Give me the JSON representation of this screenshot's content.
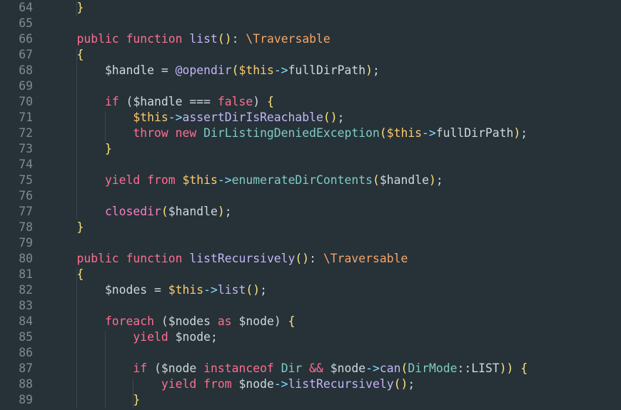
{
  "editor": {
    "first_line": 64,
    "lines": [
      {
        "n": "64",
        "tokens": [
          {
            "t": "    }",
            "c": "brace"
          }
        ]
      },
      {
        "n": "65",
        "tokens": []
      },
      {
        "n": "66",
        "tokens": [
          {
            "t": "    public",
            "c": "keyword"
          },
          {
            "t": " ",
            "c": "default"
          },
          {
            "t": "function",
            "c": "keyword"
          },
          {
            "t": " ",
            "c": "default"
          },
          {
            "t": "list",
            "c": "method"
          },
          {
            "t": "()",
            "c": "paren"
          },
          {
            "t": ": ",
            "c": "default"
          },
          {
            "t": "\\Traversable",
            "c": "type"
          }
        ]
      },
      {
        "n": "67",
        "tokens": [
          {
            "t": "    {",
            "c": "brace"
          }
        ]
      },
      {
        "n": "68",
        "tokens": [
          {
            "t": "        $handle",
            "c": "default"
          },
          {
            "t": " = ",
            "c": "default"
          },
          {
            "t": "@opendir",
            "c": "method"
          },
          {
            "t": "(",
            "c": "paren"
          },
          {
            "t": "$this",
            "c": "variable"
          },
          {
            "t": "->",
            "c": "punct"
          },
          {
            "t": "fullDirPath",
            "c": "default"
          },
          {
            "t": ")",
            "c": "paren"
          },
          {
            "t": ";",
            "c": "default"
          }
        ]
      },
      {
        "n": "69",
        "tokens": []
      },
      {
        "n": "70",
        "tokens": [
          {
            "t": "        if",
            "c": "keyword"
          },
          {
            "t": " (",
            "c": "default"
          },
          {
            "t": "$handle",
            "c": "default"
          },
          {
            "t": " === ",
            "c": "default"
          },
          {
            "t": "false",
            "c": "keyword"
          },
          {
            "t": ") ",
            "c": "default"
          },
          {
            "t": "{",
            "c": "brace"
          }
        ]
      },
      {
        "n": "71",
        "tokens": [
          {
            "t": "            $this",
            "c": "variable"
          },
          {
            "t": "->",
            "c": "punct"
          },
          {
            "t": "assertDirIsReachable",
            "c": "method"
          },
          {
            "t": "()",
            "c": "paren"
          },
          {
            "t": ";",
            "c": "default"
          }
        ]
      },
      {
        "n": "72",
        "tokens": [
          {
            "t": "            throw",
            "c": "keyword"
          },
          {
            "t": " ",
            "c": "default"
          },
          {
            "t": "new",
            "c": "keyword"
          },
          {
            "t": " ",
            "c": "default"
          },
          {
            "t": "DirListingDeniedException",
            "c": "func"
          },
          {
            "t": "(",
            "c": "paren"
          },
          {
            "t": "$this",
            "c": "variable"
          },
          {
            "t": "->",
            "c": "punct"
          },
          {
            "t": "fullDirPath",
            "c": "default"
          },
          {
            "t": ")",
            "c": "paren"
          },
          {
            "t": ";",
            "c": "default"
          }
        ]
      },
      {
        "n": "73",
        "tokens": [
          {
            "t": "        }",
            "c": "brace"
          }
        ]
      },
      {
        "n": "74",
        "tokens": []
      },
      {
        "n": "75",
        "tokens": [
          {
            "t": "        yield",
            "c": "keyword"
          },
          {
            "t": " ",
            "c": "default"
          },
          {
            "t": "from",
            "c": "keyword"
          },
          {
            "t": " ",
            "c": "default"
          },
          {
            "t": "$this",
            "c": "variable"
          },
          {
            "t": "->",
            "c": "punct"
          },
          {
            "t": "enumerateDirContents",
            "c": "func"
          },
          {
            "t": "(",
            "c": "paren"
          },
          {
            "t": "$handle",
            "c": "default"
          },
          {
            "t": ")",
            "c": "paren"
          },
          {
            "t": ";",
            "c": "default"
          }
        ]
      },
      {
        "n": "76",
        "tokens": []
      },
      {
        "n": "77",
        "tokens": [
          {
            "t": "        closedir",
            "c": "builtin"
          },
          {
            "t": "(",
            "c": "paren"
          },
          {
            "t": "$handle",
            "c": "default"
          },
          {
            "t": ")",
            "c": "paren"
          },
          {
            "t": ";",
            "c": "default"
          }
        ]
      },
      {
        "n": "78",
        "tokens": [
          {
            "t": "    }",
            "c": "brace"
          }
        ]
      },
      {
        "n": "79",
        "tokens": []
      },
      {
        "n": "80",
        "tokens": [
          {
            "t": "    public",
            "c": "keyword"
          },
          {
            "t": " ",
            "c": "default"
          },
          {
            "t": "function",
            "c": "keyword"
          },
          {
            "t": " ",
            "c": "default"
          },
          {
            "t": "listRecursively",
            "c": "method"
          },
          {
            "t": "()",
            "c": "paren"
          },
          {
            "t": ": ",
            "c": "default"
          },
          {
            "t": "\\Traversable",
            "c": "type"
          }
        ]
      },
      {
        "n": "81",
        "tokens": [
          {
            "t": "    {",
            "c": "brace"
          }
        ]
      },
      {
        "n": "82",
        "tokens": [
          {
            "t": "        $nodes",
            "c": "default"
          },
          {
            "t": " = ",
            "c": "default"
          },
          {
            "t": "$this",
            "c": "variable"
          },
          {
            "t": "->",
            "c": "punct"
          },
          {
            "t": "list",
            "c": "method"
          },
          {
            "t": "()",
            "c": "paren"
          },
          {
            "t": ";",
            "c": "default"
          }
        ]
      },
      {
        "n": "83",
        "tokens": []
      },
      {
        "n": "84",
        "tokens": [
          {
            "t": "        foreach",
            "c": "keyword"
          },
          {
            "t": " (",
            "c": "default"
          },
          {
            "t": "$nodes",
            "c": "default"
          },
          {
            "t": " ",
            "c": "default"
          },
          {
            "t": "as",
            "c": "keyword"
          },
          {
            "t": " ",
            "c": "default"
          },
          {
            "t": "$node",
            "c": "default"
          },
          {
            "t": ") ",
            "c": "default"
          },
          {
            "t": "{",
            "c": "brace"
          }
        ]
      },
      {
        "n": "85",
        "tokens": [
          {
            "t": "            yield",
            "c": "keyword"
          },
          {
            "t": " ",
            "c": "default"
          },
          {
            "t": "$node",
            "c": "default"
          },
          {
            "t": ";",
            "c": "default"
          }
        ]
      },
      {
        "n": "86",
        "tokens": []
      },
      {
        "n": "87",
        "tokens": [
          {
            "t": "            if",
            "c": "keyword"
          },
          {
            "t": " (",
            "c": "default"
          },
          {
            "t": "$node",
            "c": "default"
          },
          {
            "t": " ",
            "c": "default"
          },
          {
            "t": "instanceof",
            "c": "keyword"
          },
          {
            "t": " ",
            "c": "default"
          },
          {
            "t": "Dir",
            "c": "func"
          },
          {
            "t": " ",
            "c": "default"
          },
          {
            "t": "&&",
            "c": "keyword"
          },
          {
            "t": " ",
            "c": "default"
          },
          {
            "t": "$node",
            "c": "default"
          },
          {
            "t": "->",
            "c": "punct"
          },
          {
            "t": "can",
            "c": "method"
          },
          {
            "t": "(",
            "c": "paren"
          },
          {
            "t": "DirMode",
            "c": "func"
          },
          {
            "t": "::",
            "c": "default"
          },
          {
            "t": "LIST",
            "c": "default"
          },
          {
            "t": "))",
            "c": "paren"
          },
          {
            "t": " ",
            "c": "default"
          },
          {
            "t": "{",
            "c": "brace"
          }
        ]
      },
      {
        "n": "88",
        "tokens": [
          {
            "t": "                yield",
            "c": "keyword"
          },
          {
            "t": " ",
            "c": "default"
          },
          {
            "t": "from",
            "c": "keyword"
          },
          {
            "t": " ",
            "c": "default"
          },
          {
            "t": "$node",
            "c": "default"
          },
          {
            "t": "->",
            "c": "punct"
          },
          {
            "t": "listRecursively",
            "c": "method"
          },
          {
            "t": "()",
            "c": "paren"
          },
          {
            "t": ";",
            "c": "default"
          }
        ]
      },
      {
        "n": "89",
        "tokens": [
          {
            "t": "            }",
            "c": "brace"
          }
        ]
      }
    ]
  },
  "colors": {
    "background": "#263238",
    "line_number": "#7e8c92",
    "default": "#cfd8dc",
    "keyword": "#ff6d8f",
    "method": "#c3b5f5",
    "variable": "#ffcb6b",
    "type": "#f7a468",
    "brace": "#ffe27a",
    "function_name": "#80cbc4",
    "indent_guide": "#37474f"
  }
}
